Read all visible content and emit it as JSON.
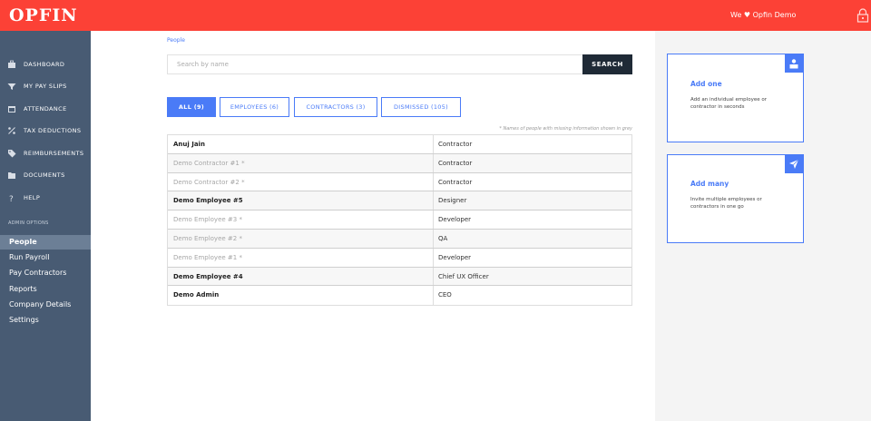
{
  "app": {
    "logo": "OPFIN",
    "account_label": "We ♥ Opfin Demo",
    "lock_icon": "lock-icon",
    "colors": {
      "brand": "#fc4136",
      "sidebar": "#485b73",
      "accent": "#4a7bf7",
      "dark": "#1f2a36"
    }
  },
  "sidebar": {
    "items": [
      {
        "label": "DASHBOARD",
        "icon": "briefcase-icon"
      },
      {
        "label": "MY PAY SLIPS",
        "icon": "funnel-icon"
      },
      {
        "label": "ATTENDANCE",
        "icon": "calendar-icon"
      },
      {
        "label": "TAX DEDUCTIONS",
        "icon": "percent-icon"
      },
      {
        "label": "REIMBURSEMENTS",
        "icon": "tag-icon"
      },
      {
        "label": "DOCUMENTS",
        "icon": "folder-icon"
      },
      {
        "label": "HELP",
        "icon": "question-icon"
      }
    ],
    "admin_title": "ADMIN OPTIONS",
    "admin_items": [
      {
        "label": "People",
        "active": true
      },
      {
        "label": "Run Payroll"
      },
      {
        "label": "Pay Contractors"
      },
      {
        "label": "Reports"
      },
      {
        "label": "Company Details"
      },
      {
        "label": "Settings"
      }
    ]
  },
  "main": {
    "breadcrumb": "People",
    "search": {
      "placeholder": "Search by name",
      "value": "",
      "button_label": "SEARCH"
    },
    "tabs": [
      {
        "label": "ALL (9)",
        "active": true
      },
      {
        "label": "EMPLOYEES (6)"
      },
      {
        "label": "CONTRACTORS (3)"
      },
      {
        "label": "DISMISSED (105)"
      }
    ],
    "note": "* Names of people with missing information shown in grey",
    "people": [
      {
        "name": "Anuj Jain",
        "role": "Contractor",
        "missing": false
      },
      {
        "name": "Demo Contractor #1 *",
        "role": "Contractor",
        "missing": true
      },
      {
        "name": "Demo Contractor #2 *",
        "role": "Contractor",
        "missing": true
      },
      {
        "name": "Demo Employee #5",
        "role": "Designer",
        "missing": false
      },
      {
        "name": "Demo Employee #3 *",
        "role": "Developer",
        "missing": true
      },
      {
        "name": "Demo Employee #2 *",
        "role": "QA",
        "missing": true
      },
      {
        "name": "Demo Employee #1 *",
        "role": "Developer",
        "missing": true
      },
      {
        "name": "Demo Employee #4",
        "role": "Chief UX Officer",
        "missing": false
      },
      {
        "name": "Demo Admin",
        "role": "CEO",
        "missing": false
      }
    ]
  },
  "right_panel": {
    "add_one": {
      "title": "Add one",
      "description": "Add an individual employee or contractor in seconds",
      "icon": "user-icon"
    },
    "add_many": {
      "title": "Add many",
      "description": "Invite multiple employees or contractors in one go",
      "icon": "send-icon"
    }
  }
}
